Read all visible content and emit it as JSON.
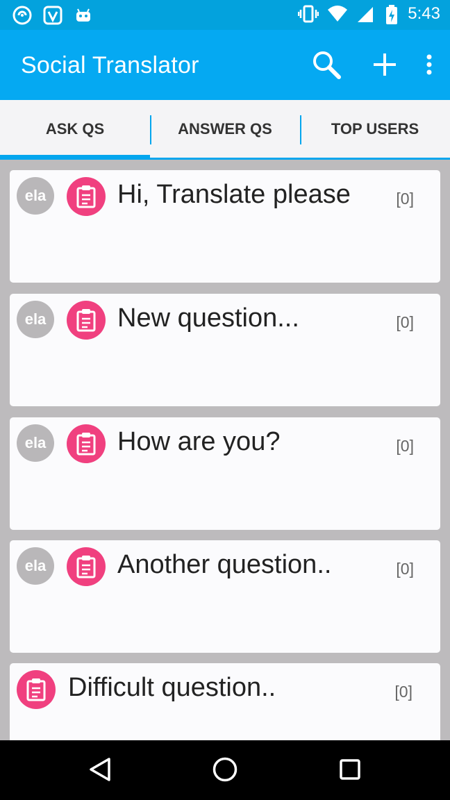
{
  "status_bar": {
    "time": "5:43",
    "left_icons": [
      "app-notification-icon",
      "saavn-icon",
      "android-icon"
    ],
    "right_icons": [
      "vibrate-icon",
      "wifi-icon",
      "signal-icon",
      "battery-charging-icon"
    ]
  },
  "app_bar": {
    "title": "Social Translator",
    "actions": [
      "search-icon",
      "add-icon",
      "overflow-menu-icon"
    ]
  },
  "tabs": [
    {
      "label": "ASK QS",
      "active": true
    },
    {
      "label": "ANSWER QS",
      "active": false
    },
    {
      "label": "TOP USERS",
      "active": false
    }
  ],
  "questions": [
    {
      "avatar": "ela",
      "title": "Hi, Translate please",
      "count": "[0]"
    },
    {
      "avatar": "ela",
      "title": "New question...",
      "count": "[0]"
    },
    {
      "avatar": "ela",
      "title": "How are you?",
      "count": "[0]"
    },
    {
      "avatar": "ela",
      "title": "Another question..",
      "count": "[0]"
    },
    {
      "avatar": "",
      "title": "Difficult question..",
      "count": "[0]"
    }
  ],
  "colors": {
    "status_bar": "#03a2dd",
    "app_bar": "#05a9f2",
    "accent": "#04a6ee",
    "question_icon": "#f0407f",
    "avatar": "#b9b7b9"
  },
  "nav_bar": [
    "back-icon",
    "home-icon",
    "recents-icon"
  ]
}
